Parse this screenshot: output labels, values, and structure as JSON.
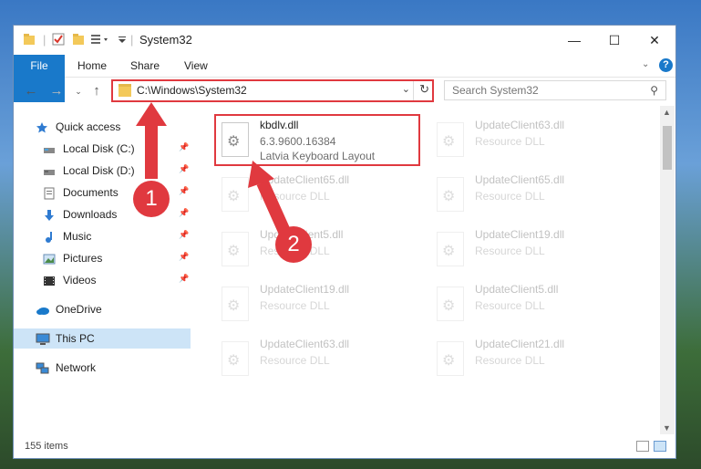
{
  "window": {
    "title": "System32",
    "controls": {
      "minimize": "—",
      "maximize": "☐",
      "close": "✕"
    }
  },
  "ribbon": {
    "tabs": [
      {
        "label": "File"
      },
      {
        "label": "Home"
      },
      {
        "label": "Share"
      },
      {
        "label": "View"
      }
    ],
    "help_icon": "?"
  },
  "navigation": {
    "address": "C:\\Windows\\System32",
    "search_placeholder": "Search System32"
  },
  "sidebar": {
    "quick_access": "Quick access",
    "items": [
      {
        "label": "Local Disk (C:)",
        "icon": "drive-icon"
      },
      {
        "label": "Local Disk (D:)",
        "icon": "drive-icon"
      },
      {
        "label": "Documents",
        "icon": "documents-icon"
      },
      {
        "label": "Downloads",
        "icon": "downloads-icon"
      },
      {
        "label": "Music",
        "icon": "music-icon"
      },
      {
        "label": "Pictures",
        "icon": "pictures-icon"
      },
      {
        "label": "Videos",
        "icon": "videos-icon"
      }
    ],
    "onedrive": "OneDrive",
    "this_pc": "This PC",
    "network": "Network"
  },
  "files": [
    {
      "name": "kbdlv.dll",
      "version": "6.3.9600.16384",
      "description": "Latvia Keyboard Layout"
    },
    {
      "name": "UpdateClient63.dll",
      "description": "Resource DLL"
    },
    {
      "name": "UpdateClient65.dll",
      "description": "Resource DLL"
    },
    {
      "name": "UpdateClient65.dll",
      "description": "Resource DLL"
    },
    {
      "name": "UpdateClient5.dll",
      "description": "Resource DLL"
    },
    {
      "name": "UpdateClient19.dll",
      "description": "Resource DLL"
    },
    {
      "name": "UpdateClient19.dll",
      "description": "Resource DLL"
    },
    {
      "name": "UpdateClient5.dll",
      "description": "Resource DLL"
    },
    {
      "name": "UpdateClient63.dll",
      "description": "Resource DLL"
    },
    {
      "name": "UpdateClient21.dll",
      "description": "Resource DLL"
    }
  ],
  "status": {
    "item_count": "155 items"
  },
  "annotations": {
    "step1": "1",
    "step2": "2"
  },
  "colors": {
    "accent": "#1979ca",
    "highlight": "#e0393f"
  }
}
